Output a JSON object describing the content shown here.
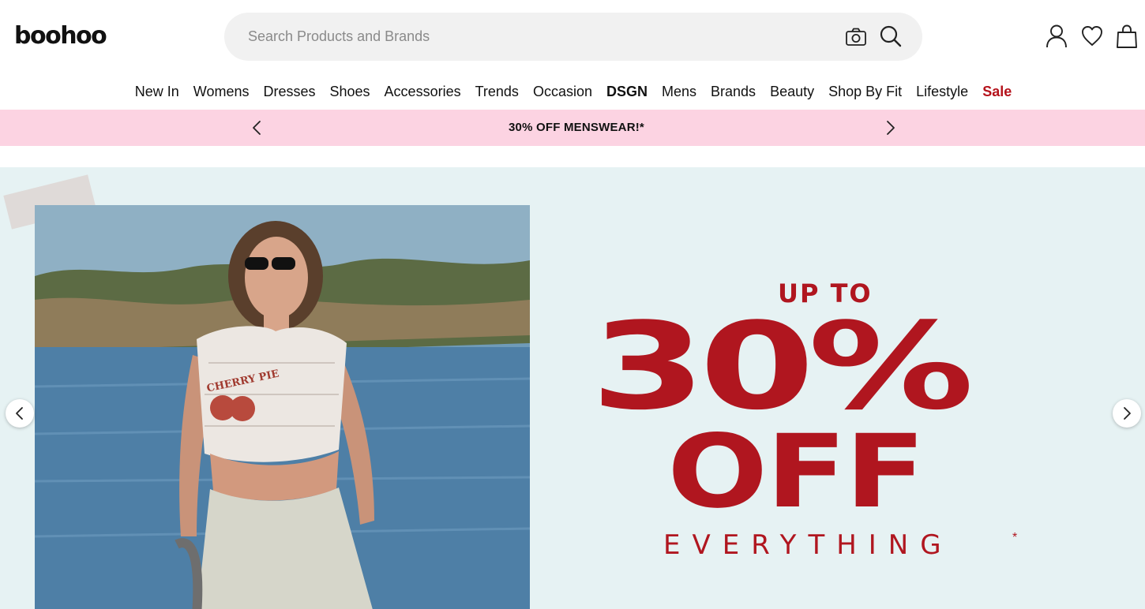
{
  "header": {
    "logo": "boohoo",
    "search_placeholder": "Search Products and Brands",
    "icons": [
      "camera-icon",
      "search-icon",
      "account-icon",
      "heart-icon",
      "bag-icon"
    ]
  },
  "nav": {
    "items": [
      {
        "label": "New In",
        "style": "normal"
      },
      {
        "label": "Womens",
        "style": "normal"
      },
      {
        "label": "Dresses",
        "style": "normal"
      },
      {
        "label": "Shoes",
        "style": "normal"
      },
      {
        "label": "Accessories",
        "style": "normal"
      },
      {
        "label": "Trends",
        "style": "normal"
      },
      {
        "label": "Occasion",
        "style": "normal"
      },
      {
        "label": "DSGN",
        "style": "bold"
      },
      {
        "label": "Mens",
        "style": "normal"
      },
      {
        "label": "Brands",
        "style": "normal"
      },
      {
        "label": "Beauty",
        "style": "normal"
      },
      {
        "label": "Shop By Fit",
        "style": "normal"
      },
      {
        "label": "Lifestyle",
        "style": "normal"
      },
      {
        "label": "Sale",
        "style": "sale"
      }
    ]
  },
  "promo": {
    "text": "30% OFF MENSWEAR!*",
    "background": "#fcd3e2"
  },
  "hero": {
    "line1": "UP TO",
    "line2": "30%",
    "line3": "OFF",
    "line4": "EVERYTHING",
    "asterisk": "*",
    "photo_shirt_text": "CHERRY PIE",
    "accent": "#b0161f",
    "background": "#e6f2f3"
  },
  "colors": {
    "sale": "#b5121b",
    "search_bg": "#f1f1f1"
  }
}
